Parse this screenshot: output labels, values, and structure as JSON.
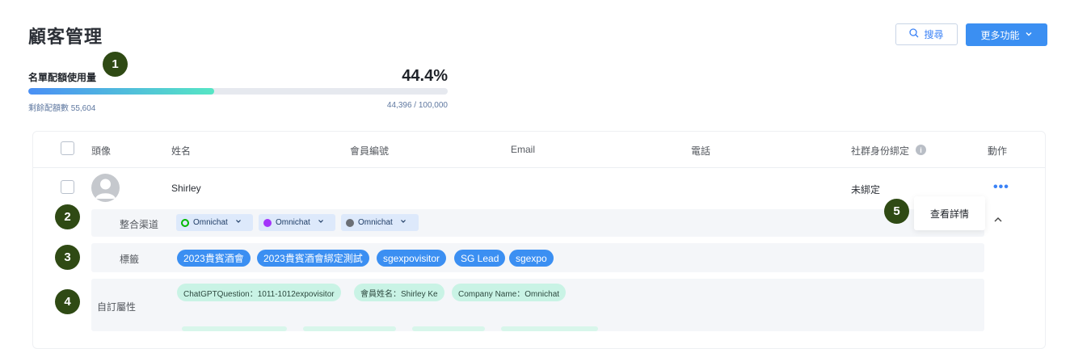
{
  "header": {
    "title": "顧客管理",
    "search_label": "搜尋",
    "more_label": "更多功能"
  },
  "quota": {
    "label": "名單配額使用量",
    "percent_text": "44.4%",
    "fill_percent": 44.4,
    "remaining_text": "剩餘配額數 55,604",
    "count_text": "44,396 / 100,000"
  },
  "badges": [
    "1",
    "2",
    "3",
    "4",
    "5"
  ],
  "table": {
    "headers": {
      "avatar": "頭像",
      "name": "姓名",
      "member_id": "會員編號",
      "email": "Email",
      "phone": "電話",
      "social": "社群身份綁定",
      "action": "動作"
    },
    "row": {
      "name": "Shirley",
      "social_status": "未綁定",
      "actions_icon": "more-dots-icon",
      "popup_label": "查看詳情",
      "channels_label": "整合渠道",
      "channels": [
        {
          "label": "Omnichat",
          "icon": "line-icon",
          "color": "#00b900"
        },
        {
          "label": "Omnichat",
          "icon": "messenger-icon",
          "color": "#a334fa"
        },
        {
          "label": "Omnichat",
          "icon": "whatsapp-icon",
          "color": "#6b6f75"
        }
      ],
      "tags_label": "標籤",
      "tags": [
        "2023貴賓酒會",
        "2023貴賓酒會綁定測試",
        "sgexpovisitor",
        "SG Lead",
        "sgexpo"
      ],
      "attributes_label": "自訂屬性",
      "attributes": [
        "ChatGPTQuestion：1011-1012expovisitor",
        "會員姓名：Shirley Ke",
        "Company Name：Omnichat"
      ]
    }
  },
  "colors": {
    "accent": "#3b8ff2",
    "badge": "#2f4a14",
    "tag_bg": "#3b8ff2",
    "attr_bg": "#c9f3e5"
  }
}
